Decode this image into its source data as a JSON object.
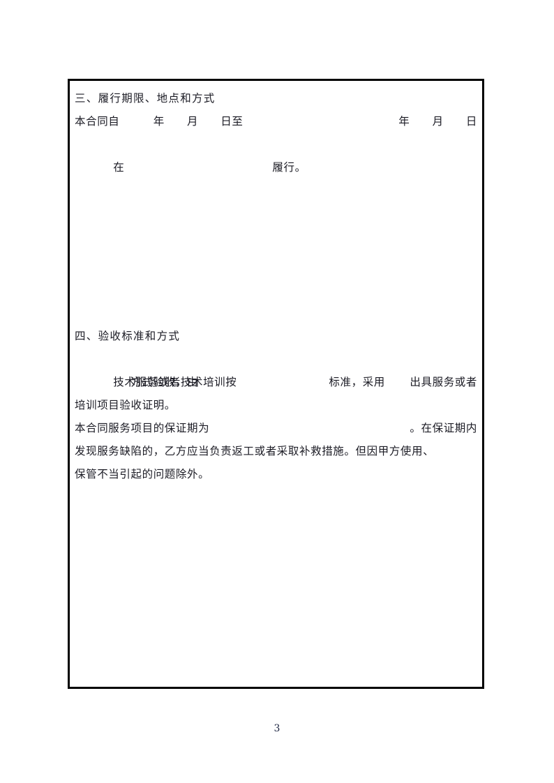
{
  "document": {
    "page_number": "3",
    "border_color": "#000000",
    "text_color": "#1b1b24",
    "background_color": "#ffffff"
  },
  "sections": {
    "section_three": {
      "heading": "三、履行期限、地点和方式",
      "line_1_left": "本合同自　　　年　　月　　日至",
      "line_1_right": "年　　月　　日",
      "line_2_left": "在",
      "line_2_right": "履行。　　　　　　　　　　　　"
    },
    "section_four": {
      "heading": "四、验收标准和方式",
      "line_1_left": "技术服务或者技术培训按",
      "line_1_right": "标准，采用　　　",
      "line_2_left": "　　　　　方式验收，由",
      "line_2_right": "出具服务或者",
      "line_3": "培训项目验收证明。",
      "warranty_line_1_left": "本合同服务项目的保证期为",
      "warranty_line_1_right": "。在保证期内",
      "warranty_line_2": "发现服务缺陷的，乙方应当负责返工或者采取补救措施。但因甲方使用、",
      "warranty_line_3": "保管不当引起的问题除外。"
    }
  }
}
